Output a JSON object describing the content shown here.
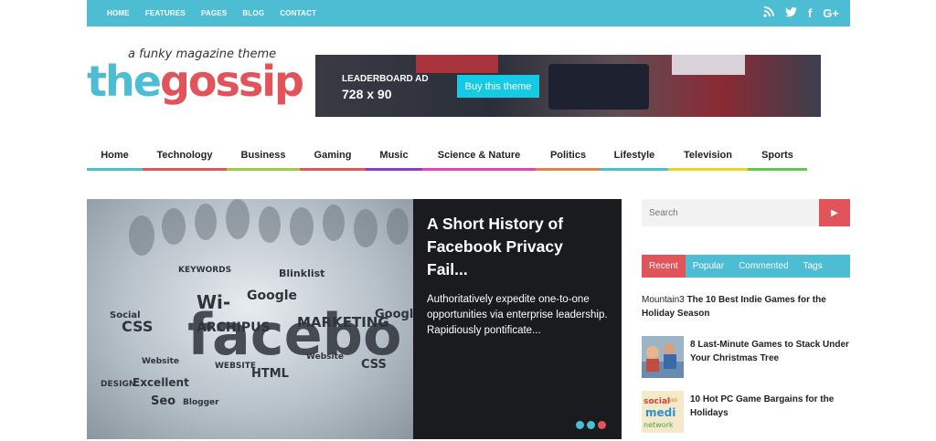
{
  "topnav": {
    "items": [
      "HOME",
      "FEATURES",
      "PAGES",
      "BLOG",
      "CONTACT"
    ],
    "social_icons": [
      "rss-icon",
      "twitter-icon",
      "facebook-icon",
      "google-plus-icon"
    ],
    "social_glyphs": [
      "⦿",
      "🐦",
      "f",
      "G+"
    ]
  },
  "logo": {
    "tagline": "a funky magazine theme",
    "the": "the",
    "gossip": "gossip"
  },
  "leaderboard": {
    "label": "LEADERBOARD AD",
    "size": "728 x 90",
    "button": "Buy this theme"
  },
  "mainnav": {
    "items": [
      {
        "label": "Home",
        "color": "#4dbdd4"
      },
      {
        "label": "Technology",
        "color": "#e0545a"
      },
      {
        "label": "Business",
        "color": "#a3c94a"
      },
      {
        "label": "Gaming",
        "color": "#e0545a"
      },
      {
        "label": "Music",
        "color": "#8e3bc7"
      },
      {
        "label": "Science & Nature",
        "color": "#e046b8"
      },
      {
        "label": "Politics",
        "color": "#e0834a"
      },
      {
        "label": "Lifestyle",
        "color": "#4dbdd4"
      },
      {
        "label": "Television",
        "color": "#e8d61a"
      },
      {
        "label": "Sports",
        "color": "#5fc94a"
      }
    ]
  },
  "slider": {
    "title": "A Short History of Facebook Privacy Fail...",
    "excerpt": "Authoritatively expedite one-to-one opportunities via enterprise leadership. Rapidiously pontificate..."
  },
  "search": {
    "placeholder": "Search"
  },
  "tabs": [
    "Recent",
    "Popular",
    "Commented",
    "Tags"
  ],
  "posts": [
    {
      "label": "Mountain3",
      "title": "The 10 Best Indie Games for the Holiday Season"
    },
    {
      "title": "8 Last-Minute Games to Stack Under Your Christmas Tree"
    },
    {
      "title": "10 Hot PC Game Bargains for the Holidays"
    }
  ],
  "colors": {
    "accent_blue": "#4dbdd4",
    "accent_red": "#e0545a"
  }
}
